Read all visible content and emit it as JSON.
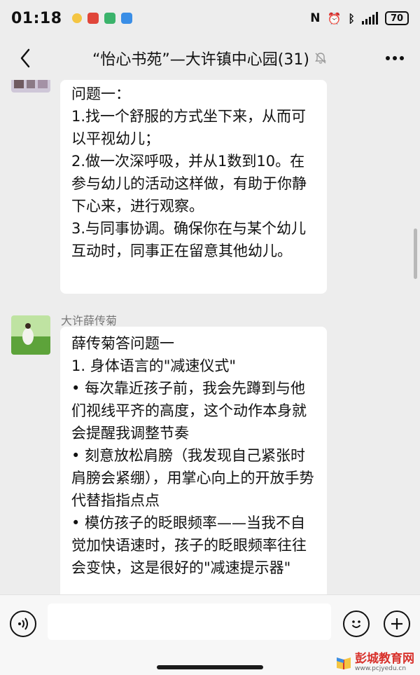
{
  "status_bar": {
    "time": "01:18",
    "battery": "70"
  },
  "nav": {
    "title": "“怡心书苑”—大许镇中心园(31)"
  },
  "messages": [
    {
      "sender": "",
      "lines": [
        "问题一：",
        "1.找一个舒服的方式坐下来，从而可以平视幼儿；",
        "2.做一次深呼吸，并从1数到10。在参与幼儿的活动这样做，有助于你静下心来，进行观察。",
        "3.与同事协调。确保你在与某个幼儿互动时，同事正在留意其他幼儿。"
      ]
    },
    {
      "sender": "大许薛传菊",
      "lines": [
        "薛传菊答问题一",
        "1. 身体语言的\"减速仪式\"",
        "• 每次靠近孩子前，我会先蹲到与他们视线平齐的高度，这个动作本身就会提醒我调整节奏",
        "• 刻意放松肩膀（我发现自己紧张时肩膀会紧绷），用掌心向上的开放手势代替指指点点",
        "• 模仿孩子的眨眼频率——当我不自觉加快语速时，孩子的眨眼频率往往会变快，这是很好的\"减速提示器\""
      ]
    }
  ],
  "input": {
    "placeholder": ""
  },
  "watermark": {
    "title": "彭城教育网",
    "url": "www.pcjyedu.cn"
  },
  "icons": {
    "back": "back-arrow-icon",
    "mute": "bell-muted-icon",
    "more": "more-dots-icon",
    "voice": "voice-icon",
    "emoji": "emoji-icon",
    "plus": "plus-icon"
  }
}
